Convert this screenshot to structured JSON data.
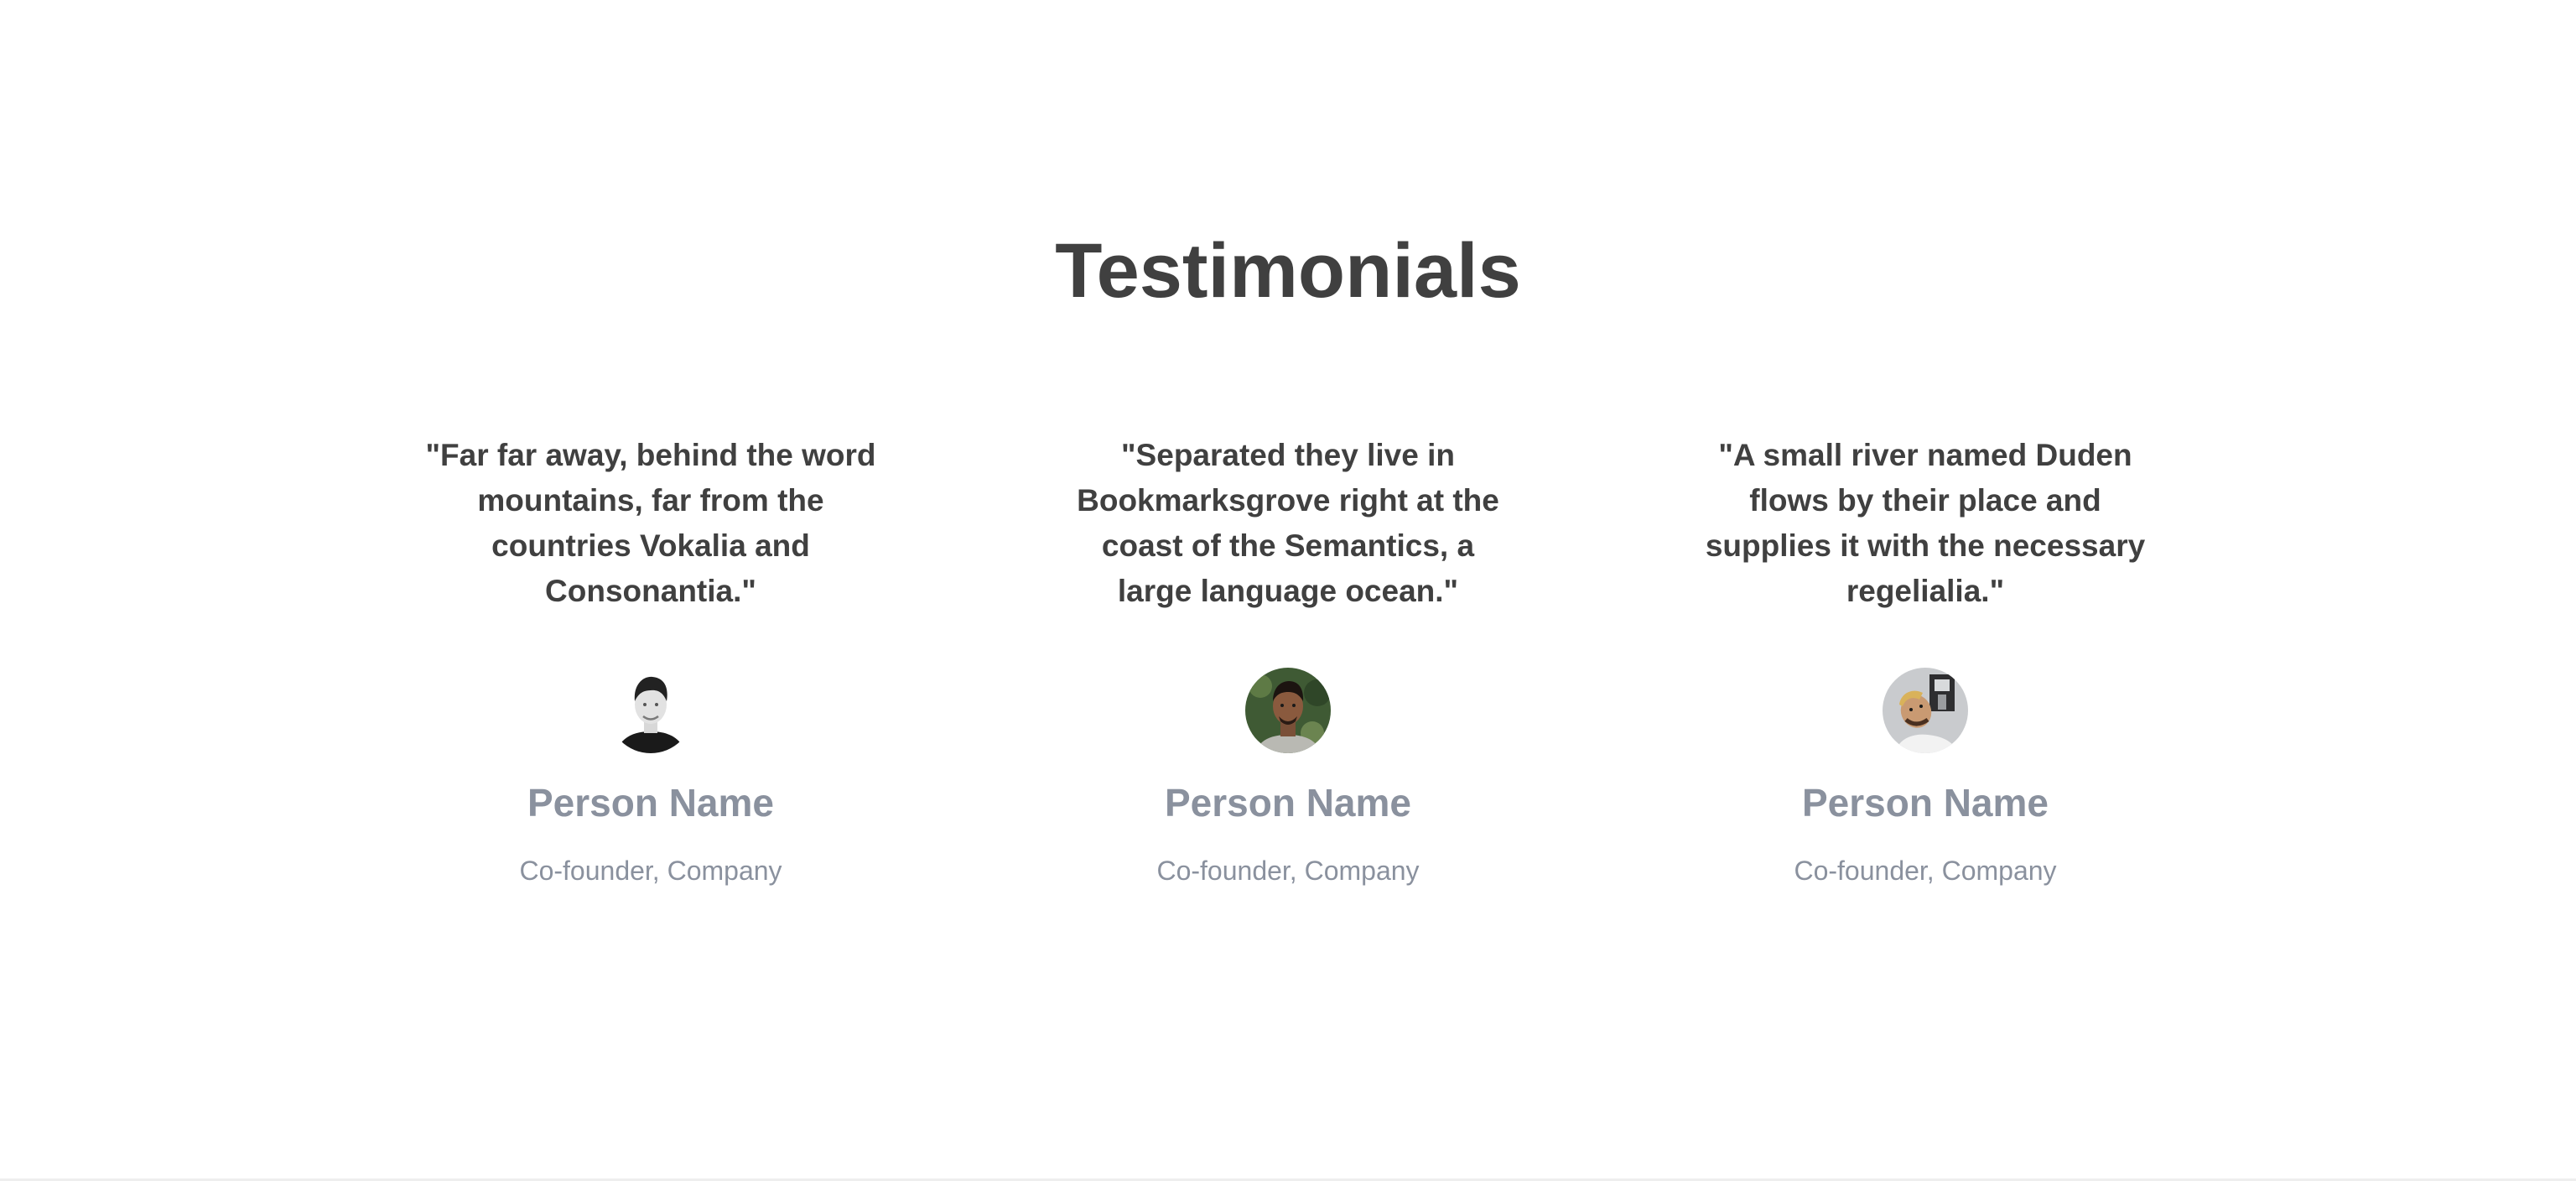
{
  "section": {
    "title": "Testimonials"
  },
  "testimonials": [
    {
      "quote": "\"Far far away, behind the word mountains, far from the countries Vokalia and Consonantia.\"",
      "name": "Person Name",
      "role": "Co-founder, Company",
      "avatar": "person-photo-bw"
    },
    {
      "quote": "\"Separated they live in Bookmarksgrove right at the coast of the Semantics, a large language ocean.\"",
      "name": "Person Name",
      "role": "Co-founder, Company",
      "avatar": "person-photo-green-background"
    },
    {
      "quote": "\"A small river named Duden flows by their place and supplies it with the necessary regelialia.\"",
      "name": "Person Name",
      "role": "Co-founder, Company",
      "avatar": "person-photo-grey-background"
    }
  ],
  "colors": {
    "heading": "#404040",
    "quote_text": "#404040",
    "muted_text": "#8a919e",
    "background": "#ffffff"
  }
}
